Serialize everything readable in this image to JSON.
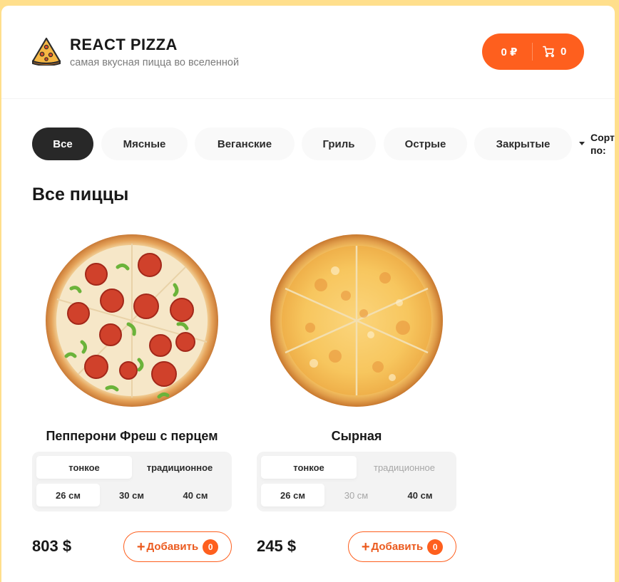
{
  "header": {
    "title": "REACT PIZZA",
    "subtitle": "самая вкусная пицца во вселенной",
    "cart_price": "0 ₽",
    "cart_count": "0"
  },
  "categories": [
    "Все",
    "Мясные",
    "Веганские",
    "Гриль",
    "Острые",
    "Закрытые"
  ],
  "active_category": "Все",
  "sort": {
    "label": "Сортировка по:"
  },
  "content_title": "Все пиццы",
  "pizzas": [
    {
      "title": "Пепперони Фреш с перцем",
      "types": [
        "тонкое",
        "традиционное"
      ],
      "active_type": "тонкое",
      "sizes": [
        "26 см",
        "30 см",
        "40 см"
      ],
      "active_size": "26 см",
      "price": "803 $",
      "add_label": "Добавить",
      "add_count": "0"
    },
    {
      "title": "Сырная",
      "types": [
        "тонкое",
        "традиционное"
      ],
      "active_type": "тонкое",
      "disabled_type": "традиционное",
      "sizes": [
        "26 см",
        "30 см",
        "40 см"
      ],
      "active_size": "26 см",
      "disabled_size": "30 см",
      "price": "245 $",
      "add_label": "Добавить",
      "add_count": "0"
    }
  ],
  "colors": {
    "accent": "#fe5f1e",
    "background": "#ffdf8c",
    "dark": "#282828"
  }
}
